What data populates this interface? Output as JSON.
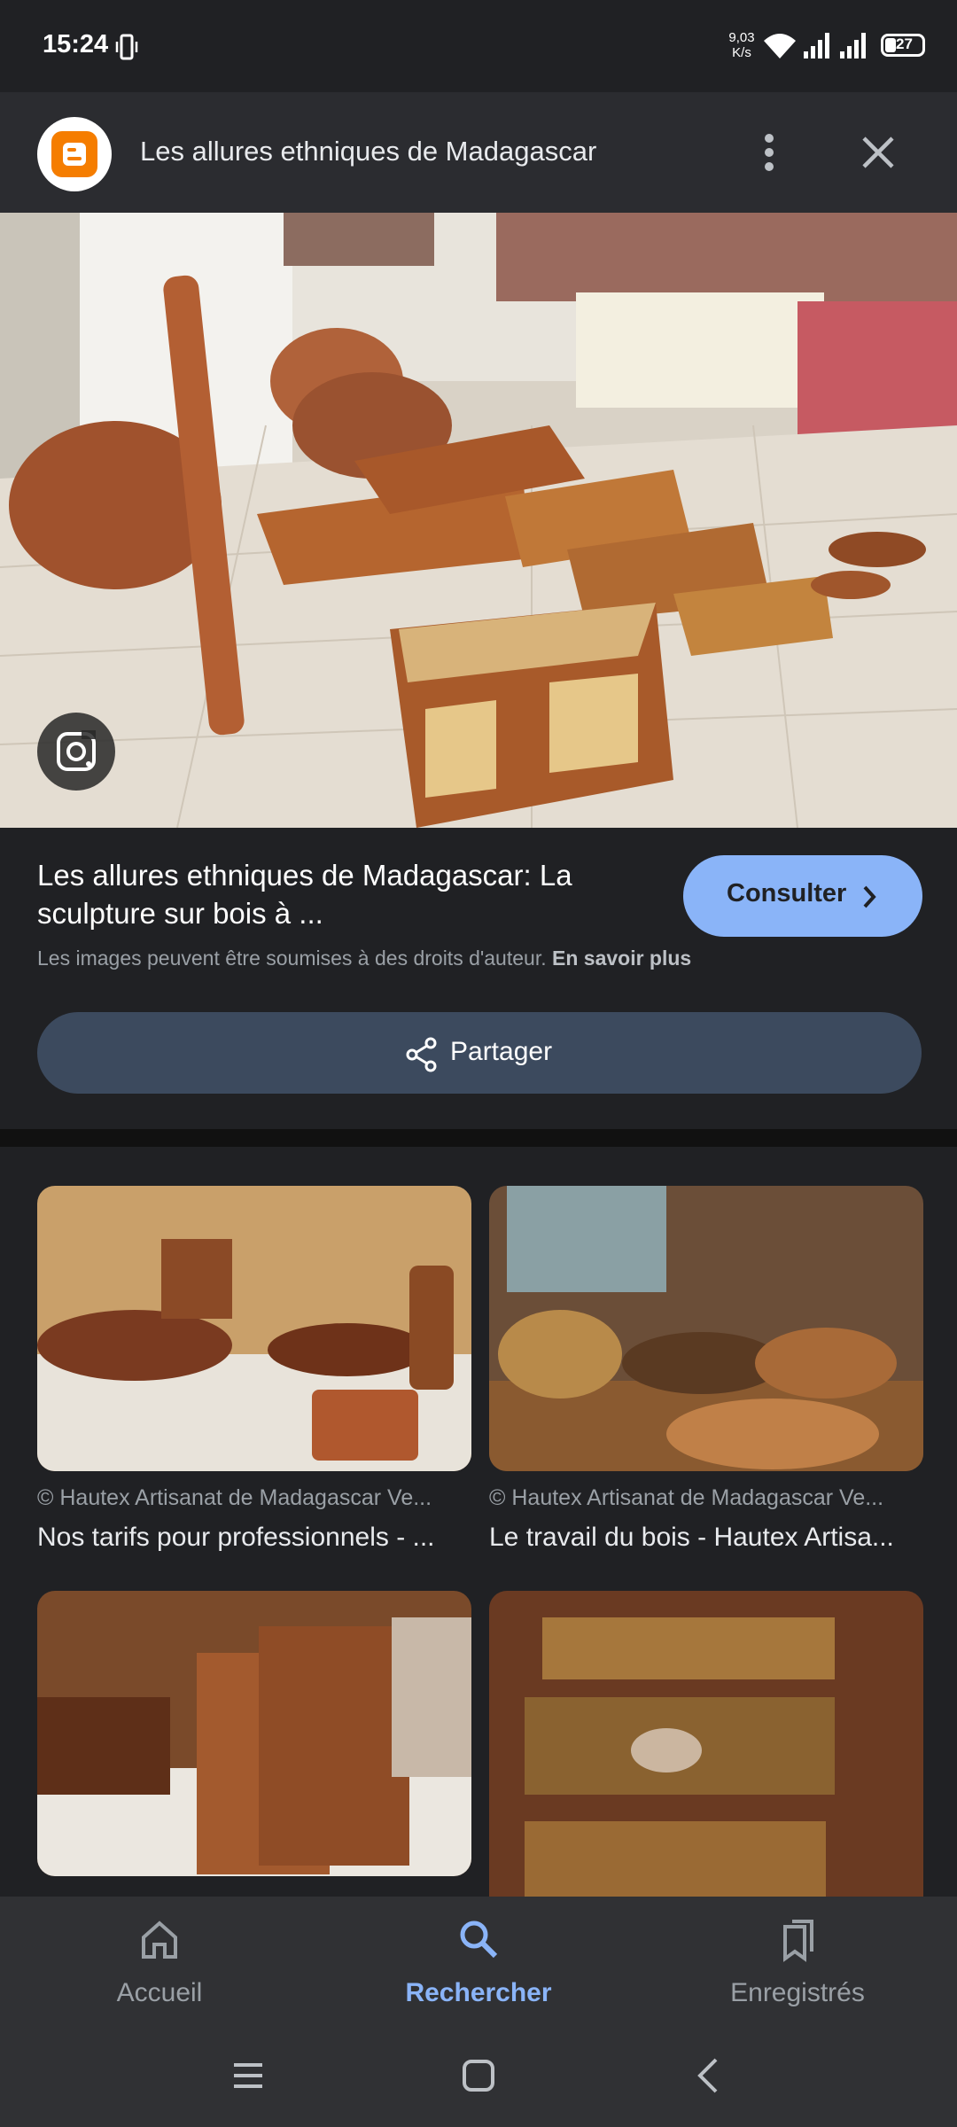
{
  "status_bar": {
    "time": "15:24",
    "net_speed_value": "9,03",
    "net_speed_unit": "K/s",
    "battery": "27"
  },
  "header": {
    "title": "Les allures ethniques de Madagascar",
    "logo_icon": "blogger-icon",
    "more_icon": "more-vert-icon",
    "close_icon": "close-icon"
  },
  "result": {
    "title": "Les allures ethniques de Madagascar: La sculpture sur bois à ...",
    "consult_label": "Consulter",
    "copyright_text": "Les images peuvent être soumises à des droits d'auteur.",
    "learn_more": "En savoir plus",
    "share_label": "Partager"
  },
  "related": [
    {
      "source": "Hautex Artisanat de Madagascar Ve...",
      "caption": "Nos tarifs pour professionnels - ..."
    },
    {
      "source": "Hautex Artisanat de Madagascar Ve...",
      "caption": "Le travail du bois - Hautex Artisa..."
    },
    {
      "source": "",
      "caption": ""
    },
    {
      "source": "",
      "caption": ""
    }
  ],
  "bottom_nav": {
    "items": [
      {
        "label": "Accueil",
        "icon": "home-icon",
        "active": false
      },
      {
        "label": "Rechercher",
        "icon": "search-icon",
        "active": true
      },
      {
        "label": "Enregistrés",
        "icon": "bookmarks-icon",
        "active": false
      }
    ]
  },
  "colors": {
    "background": "#202124",
    "accent": "#8ab4f8",
    "share_button": "#3c4a5e",
    "nav_bar": "#303134"
  }
}
